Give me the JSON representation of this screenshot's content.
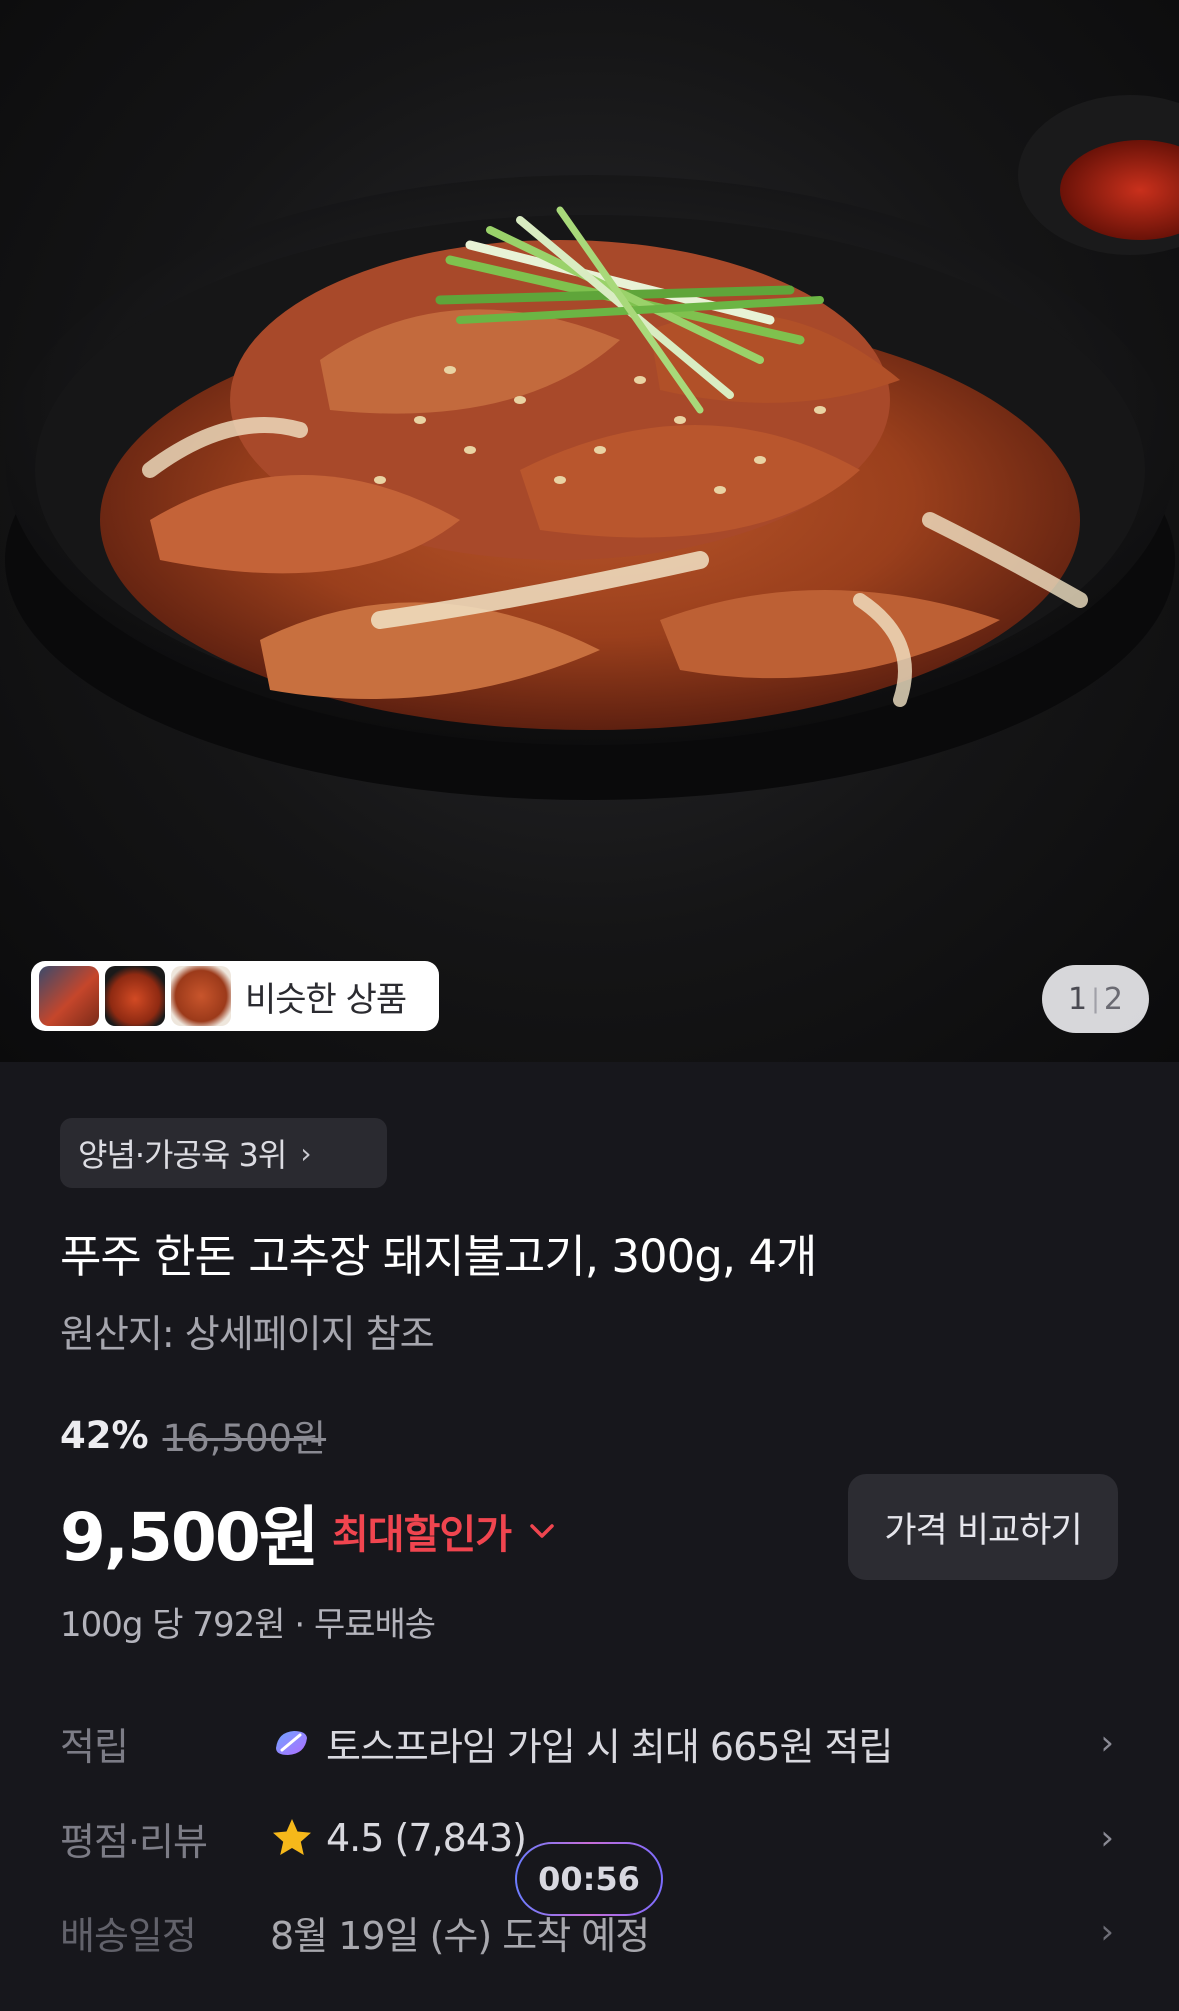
{
  "hero": {
    "similar_products_label": "비슷한 상품",
    "pager_current": "1",
    "pager_separator": "|",
    "pager_total": "2"
  },
  "product": {
    "category_chip": "양념·가공육 3위",
    "title": "푸주 한돈 고추장 돼지불고기, 300g, 4개",
    "origin": "원산지: 상세페이지 참조",
    "discount_percent": "42%",
    "original_price": "16,500원",
    "price": "9,500원",
    "max_discount_label": "최대할인가",
    "compare_button": "가격 비교하기",
    "unit_price": "100g 당 792원 · 무료배송"
  },
  "info_rows": {
    "points_label": "적립",
    "points_value": "토스프라임 가입 시 최대 665원 적립",
    "rating_label": "평점·리뷰",
    "rating_value": "4.5 (7,843)",
    "delivery_label": "배송일정",
    "delivery_value": "8월 19일 (수) 도착 예정"
  },
  "timer": "00:56",
  "colors": {
    "background": "#17171c",
    "accent_red": "#f0454f",
    "star": "#f6b81a"
  },
  "icons": {
    "chevron": "chevron-right-icon",
    "prime": "toss-prime-icon",
    "star": "star-icon"
  }
}
